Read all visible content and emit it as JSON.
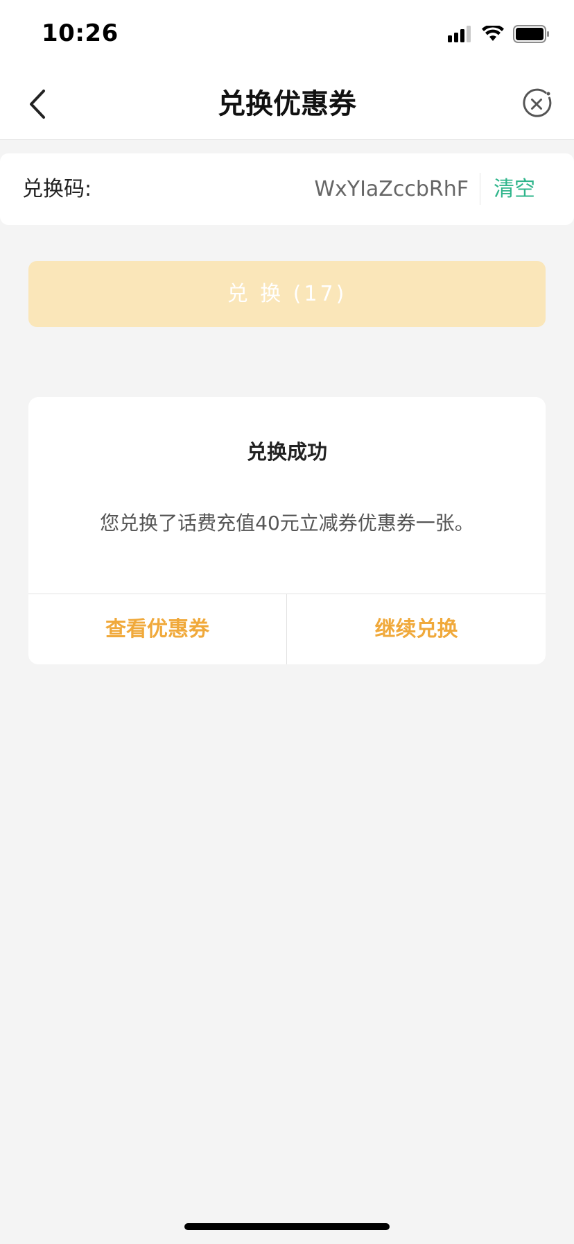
{
  "status_bar": {
    "time": "10:26"
  },
  "nav": {
    "title": "兑换优惠券",
    "back_icon": "chevron-left-icon",
    "close_icon": "close-circle-icon"
  },
  "code_row": {
    "label": "兑换码:",
    "value": "WxYIaZccbRhF",
    "clear_label": "清空"
  },
  "redeem_button": {
    "label": "兑 换 (17)"
  },
  "dialog": {
    "title": "兑换成功",
    "message": "您兑换了话费充值40元立减券优惠券一张。",
    "view_label": "查看优惠券",
    "continue_label": "继续兑换"
  },
  "colors": {
    "accent_green": "#2fb58b",
    "accent_orange": "#f0a93b",
    "button_disabled": "#fae6b9",
    "background": "#f4f4f4"
  }
}
